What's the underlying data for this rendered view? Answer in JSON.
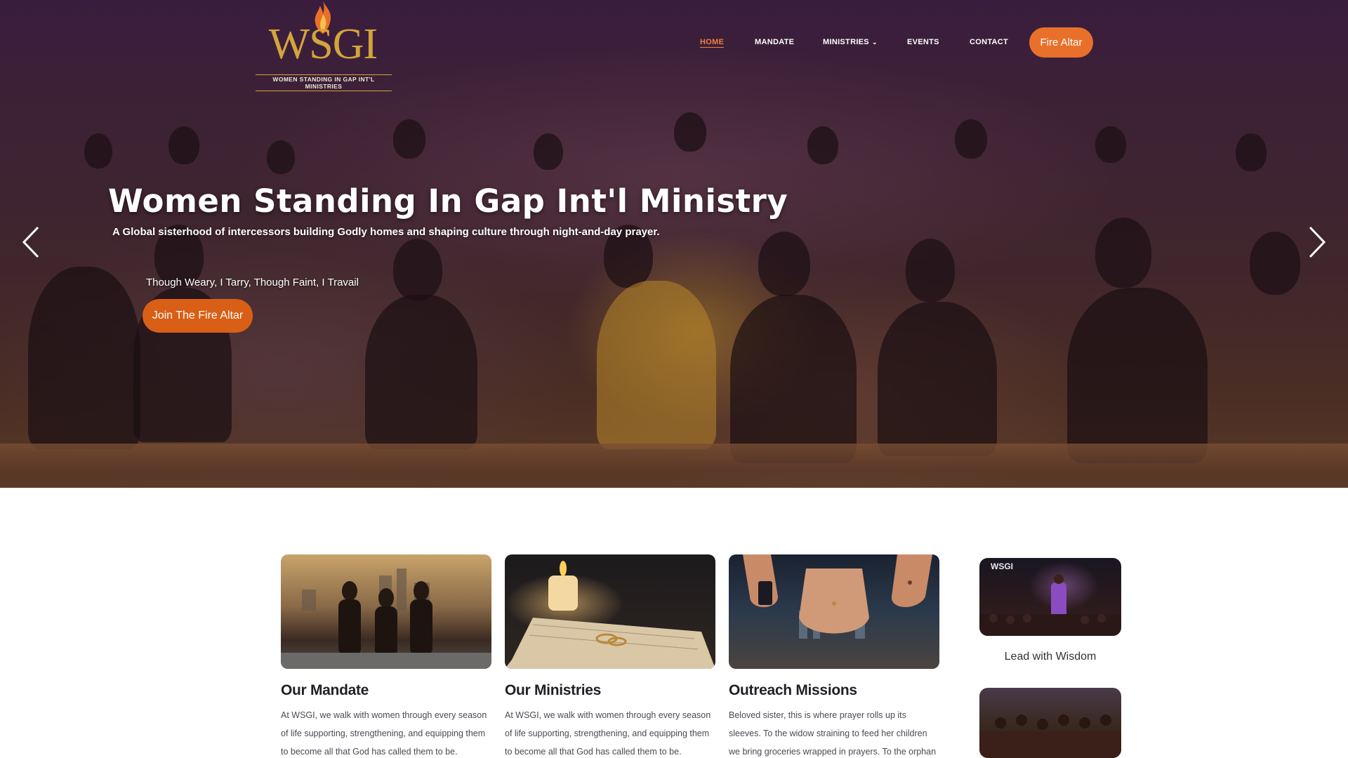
{
  "brand": {
    "logo_text": "WSGI",
    "logo_subtitle": "WOMEN STANDING IN GAP INT'L MINISTRIES",
    "accent": "#e8702a",
    "gold": "#d4a43c"
  },
  "nav": {
    "items": [
      {
        "label": "HOME",
        "active": true
      },
      {
        "label": "MANDATE",
        "active": false
      },
      {
        "label": "MINISTRIES",
        "active": false,
        "icon": "chevron-down-icon"
      },
      {
        "label": "EVENTS",
        "active": false
      },
      {
        "label": "CONTACT",
        "active": false
      }
    ],
    "cta_label": "Fire Altar"
  },
  "hero": {
    "title": "Women Standing In Gap Int'l Ministry",
    "subtitle": "A Global sisterhood of intercessors building Godly homes and shaping culture through night-and-day prayer.",
    "motto": "Though Weary, I Tarry, Though Faint, I Travail",
    "cta_label": "Join The Fire Altar",
    "prev_icon": "chevron-left-icon",
    "next_icon": "chevron-right-icon"
  },
  "cards": [
    {
      "title": "Our Mandate",
      "text": "At WSGI, we walk with women through every season of life supporting, strengthening, and equipping them to become all that God has called them to be. Through"
    },
    {
      "title": "Our Ministries",
      "text": "At WSGI, we walk with women through every season of life supporting, strengthening, and equipping them to become all that God has called them to be. Through"
    },
    {
      "title": "Outreach Missions",
      "text": "Beloved sister, this is where prayer rolls up its sleeves. To the widow straining to feed her children we bring groceries wrapped in prayers. To the orphan wearing"
    }
  ],
  "side_cards": [
    {
      "caption": "Lead with Wisdom",
      "image_label": "WSGI"
    },
    {
      "caption": ""
    }
  ]
}
